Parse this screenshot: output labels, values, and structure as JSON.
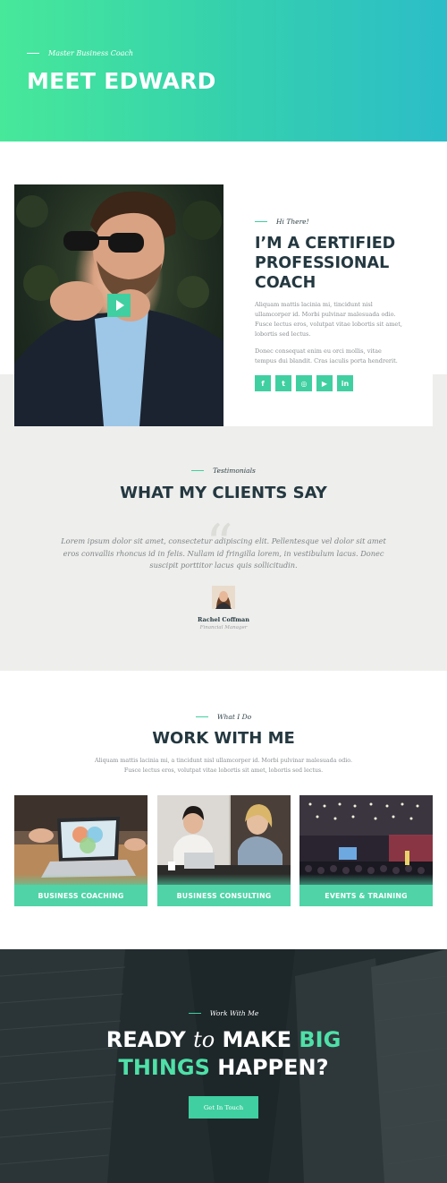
{
  "hero": {
    "kicker": "Master Business Coach",
    "title": "MEET EDWARD",
    "gradient_start": "#47e89a",
    "gradient_end": "#2cbdc8"
  },
  "about": {
    "kicker": "Hi There!",
    "title_lines": [
      "I’M A CERTIFIED",
      "PROFESSIONAL",
      "COACH"
    ],
    "para1": "Aliquam mattis lacinia mi, tincidunt nisl ullamcorper id. Morbi pulvinar malesuada odio. Fusce lectus eros, volutpat vitae lobortis sit amet, lobortis sed lectus.",
    "para2": "Donec consequat enim eu orci mollis, vitae tempus dui blandit. Cras iaculis porta hendrerit.",
    "play_icon": "play-icon",
    "socials": [
      {
        "icon": "facebook-icon",
        "glyph": "f"
      },
      {
        "icon": "twitter-icon",
        "glyph": "t"
      },
      {
        "icon": "instagram-icon",
        "glyph": "◎"
      },
      {
        "icon": "youtube-icon",
        "glyph": "▶"
      },
      {
        "icon": "linkedin-icon",
        "glyph": "in"
      }
    ]
  },
  "testimonials": {
    "kicker": "Testimonials",
    "title": "WHAT MY CLIENTS SAY",
    "quote_mark": "“",
    "quote": "Lorem ipsum dolor sit amet, consectetur adipiscing elit. Pellentesque vel dolor sit amet eros convallis rhoncus id in felis. Nullam id fringilla lorem, in vestibulum lacus. Donec suscipit porttitor lacus quis sollicitudin.",
    "name": "Rachel Coffman",
    "role": "Financial Manager"
  },
  "work": {
    "kicker": "What I Do",
    "title": "WORK WITH ME",
    "desc_line1": "Aliquam mattis lacinia mi, a tincidunt nisl ullamcorper id. Morbi pulvinar malesuada odio.",
    "desc_line2": "Fusce lectus eros, volutpat vitae lobortis sit amet, lobortis sed lectus.",
    "cards": [
      {
        "label": "BUSINESS COACHING"
      },
      {
        "label": "BUSINESS CONSULTING"
      },
      {
        "label": "EVENTS & TRAINING"
      }
    ]
  },
  "cta": {
    "kicker": "Work With Me",
    "word_ready": "READY",
    "word_to": "to",
    "word_make": "MAKE",
    "word_big": "BIG",
    "word_things": "THINGS",
    "word_happen": "HAPPEN?",
    "button": "Get In Touch",
    "accent": "#4fe0a8"
  },
  "colors": {
    "accent": "#40cfa0",
    "heading": "#243840",
    "body_text": "#8a8f92",
    "grey_band": "#eeeeec",
    "dark_bg": "#232d30"
  }
}
